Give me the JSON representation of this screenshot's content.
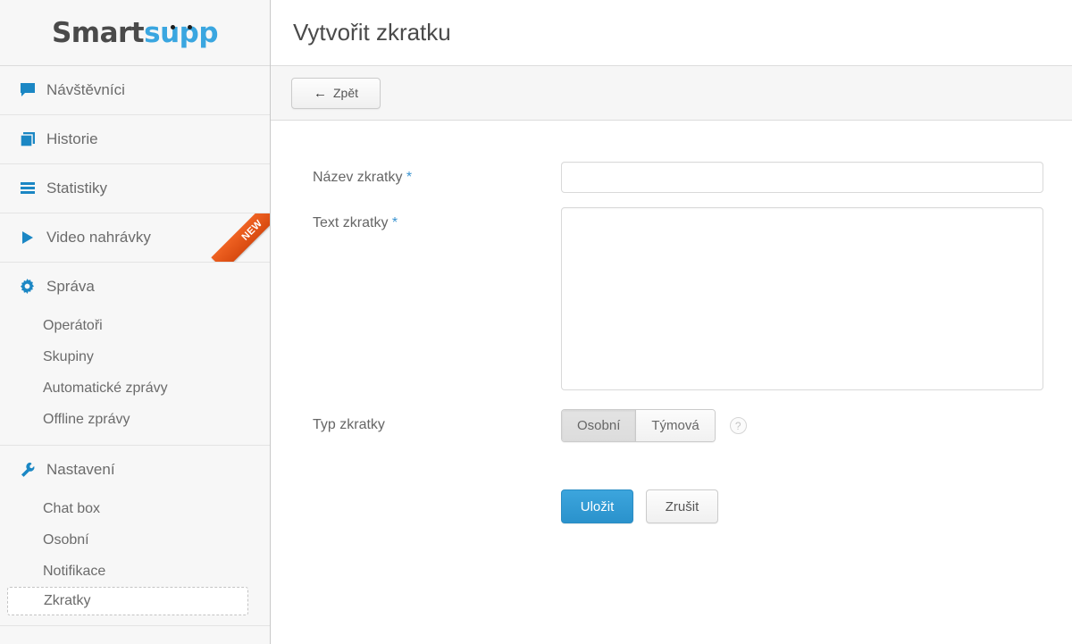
{
  "brand": {
    "logo_part1": "Smart",
    "logo_part2": "supp"
  },
  "sidebar": {
    "nav": [
      {
        "label": "Návštěvníci",
        "icon": "speech-bubble-icon",
        "badge": ""
      },
      {
        "label": "Historie",
        "icon": "book-icon",
        "badge": ""
      },
      {
        "label": "Statistiky",
        "icon": "bars-icon",
        "badge": ""
      },
      {
        "label": "Video nahrávky",
        "icon": "play-icon",
        "badge": "NEW"
      }
    ],
    "groups": [
      {
        "label": "Správa",
        "icon": "gear-icon",
        "items": [
          {
            "label": "Operátoři",
            "active": false
          },
          {
            "label": "Skupiny",
            "active": false
          },
          {
            "label": "Automatické zprávy",
            "active": false
          },
          {
            "label": "Offline zprávy",
            "active": false
          }
        ]
      },
      {
        "label": "Nastavení",
        "icon": "wrench-icon",
        "items": [
          {
            "label": "Chat box",
            "active": false
          },
          {
            "label": "Osobní",
            "active": false
          },
          {
            "label": "Notifikace",
            "active": false
          },
          {
            "label": "Zkratky",
            "active": true
          }
        ]
      }
    ]
  },
  "header": {
    "title": "Vytvořit zkratku"
  },
  "toolbar": {
    "back_label": "Zpět",
    "back_arrow": "←"
  },
  "form": {
    "name_label": "Název zkratky",
    "name_required": "*",
    "name_value": "",
    "name_placeholder": "",
    "text_label": "Text zkratky",
    "text_required": "*",
    "text_value": "",
    "text_placeholder": "",
    "type_label": "Typ zkratky",
    "type_options": [
      {
        "label": "Osobní",
        "selected": true
      },
      {
        "label": "Týmová",
        "selected": false
      }
    ],
    "help_icon_label": "?",
    "save_label": "Uložit",
    "cancel_label": "Zrušit"
  },
  "colors": {
    "accent_blue": "#2a92cc",
    "icon_blue": "#1b87c4",
    "ribbon_orange": "#e0571a",
    "sidebar_bg": "#f7f7f7",
    "toolbar_bg": "#f6f6f6"
  }
}
